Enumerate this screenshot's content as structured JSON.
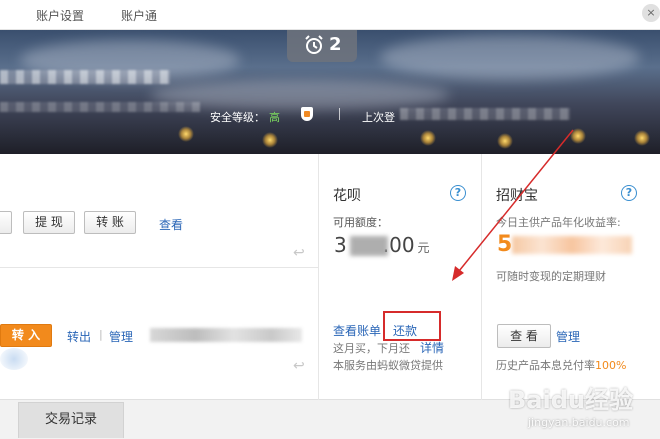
{
  "topnav": {
    "items": [
      {
        "label": "账户设置"
      },
      {
        "label": "账户通"
      }
    ],
    "corner_glyph": "×"
  },
  "banner": {
    "alarm_count": "2",
    "security_label": "安全等级：",
    "security_level": "高",
    "last_login_label": "上次登"
  },
  "balance": {
    "withdraw_label": "提 现",
    "transfer_label": "转 账",
    "view_link": "查看"
  },
  "yuebao": {
    "transfer_in_label": "转 入",
    "transfer_out_link": "转出",
    "divider": "|",
    "manage_link": "管理"
  },
  "huabei": {
    "title": "花呗",
    "help_glyph": "?",
    "credit_label": "可用额度：",
    "amount_visible_prefix": "3",
    "amount_visible_suffix": ".00",
    "amount_unit": "元",
    "bill_link": "查看账单",
    "repay_link": "还款",
    "note_line1": "这月买，下月还",
    "detail_link": "详情",
    "note_line2": "本服务由蚂蚁微贷提供"
  },
  "zhaocaibao": {
    "title": "招财宝",
    "help_glyph": "?",
    "rate_label": "今日主供产品年化收益率:",
    "rate_visible_digit": "5",
    "desc": "可随时变现的定期理财",
    "view_label": "查 看",
    "manage_link": "管理",
    "history_label": "历史产品本息兑付率",
    "history_rate": "100%"
  },
  "tabs": [
    {
      "label": "交易记录"
    }
  ],
  "watermark": {
    "word": "Baidu经验",
    "sub": "jingyan.baidu.com"
  },
  "colors": {
    "link_blue": "#2a66b7",
    "accent_orange": "#f28a1c",
    "highlight_red": "#d62b2b",
    "security_green": "#7ddc5f"
  },
  "icons": [
    "alarm-clock-icon",
    "shield-icon",
    "help-icon",
    "return-arrow-icon",
    "close-icon"
  ]
}
